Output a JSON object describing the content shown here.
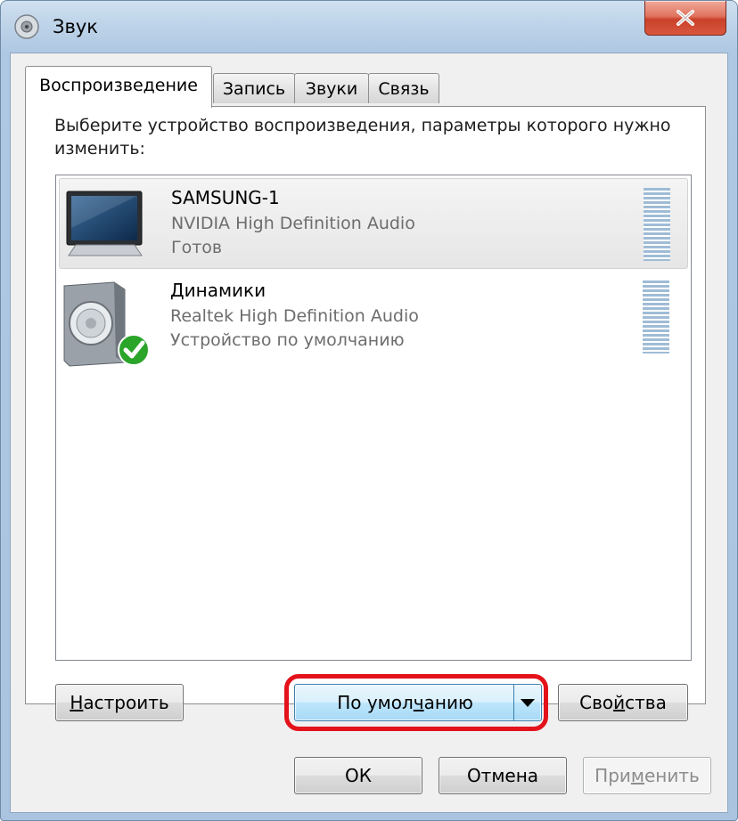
{
  "window": {
    "title": "Звук",
    "close_symbol": "x"
  },
  "tabs": [
    {
      "label": "Воспроизведение",
      "active": true
    },
    {
      "label": "Запись",
      "active": false
    },
    {
      "label": "Звуки",
      "active": false
    },
    {
      "label": "Связь",
      "active": false
    }
  ],
  "instruction": "Выберите устройство воспроизведения, параметры которого нужно изменить:",
  "devices": [
    {
      "name": "SAMSUNG-1",
      "driver": "NVIDIA High Definition Audio",
      "status": "Готов",
      "icon": "monitor-icon",
      "selected": true
    },
    {
      "name": "Динамики",
      "driver": "Realtek High Definition Audio",
      "status": "Устройство по умолчанию",
      "icon": "speaker-icon",
      "default": true
    }
  ],
  "buttons": {
    "configure": {
      "before": "",
      "accel": "Н",
      "after": "астроить"
    },
    "set_default": {
      "before": "По умол",
      "accel": "ч",
      "after": "анию"
    },
    "properties": {
      "before": "Сво",
      "accel": "й",
      "after": "ства"
    },
    "ok": "ОК",
    "cancel": "Отмена",
    "apply": {
      "before": "При",
      "accel": "м",
      "after": "енить"
    }
  },
  "colors": {
    "highlight_ring": "#e3121b",
    "default_check": "#2aa52a"
  }
}
